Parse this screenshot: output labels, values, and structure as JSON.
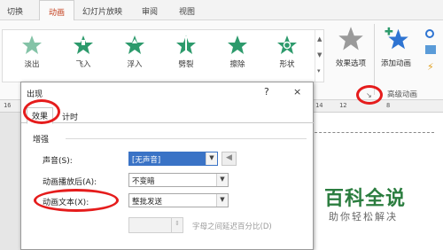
{
  "ribbon_tabs": [
    "切换",
    "动画",
    "幻灯片放映",
    "审阅",
    "视图"
  ],
  "active_tab": "动画",
  "animations": [
    "淡出",
    "飞入",
    "浮入",
    "劈裂",
    "擦除",
    "形状"
  ],
  "effect_options_label": "效果选项",
  "add_animation_label": "添加动画",
  "advanced_group_label": "高级动画",
  "ruler_labels": [
    "16",
    "14",
    "12",
    "8"
  ],
  "dialog": {
    "title": "出现",
    "help_symbol": "?",
    "close_symbol": "×",
    "tabs": [
      "效果",
      "计时"
    ],
    "selected_tab": "效果",
    "group_label": "增强",
    "sound_label": "声音(S):",
    "sound_value": "[无声音]",
    "after_label": "动画播放后(A):",
    "after_value": "不变暗",
    "text_label": "动画文本(X):",
    "text_value": "整批发送",
    "delay_label": "字母之间延迟百分比(D)"
  },
  "watermark": {
    "title": "百科全说",
    "subtitle": "助你轻松解决"
  },
  "colors": {
    "accent": "#c43e1c",
    "star_green": "#2d9a6c",
    "star_blue": "#2e74d2",
    "annotation_red": "#e51c1c",
    "watermark_green": "#2b7d3f"
  },
  "icons": [
    "animation-star-icon",
    "effect-options-star-icon",
    "add-animation-icon",
    "dialog-launcher-icon",
    "speaker-icon",
    "chevron-down-icon",
    "close-icon",
    "help-icon"
  ]
}
